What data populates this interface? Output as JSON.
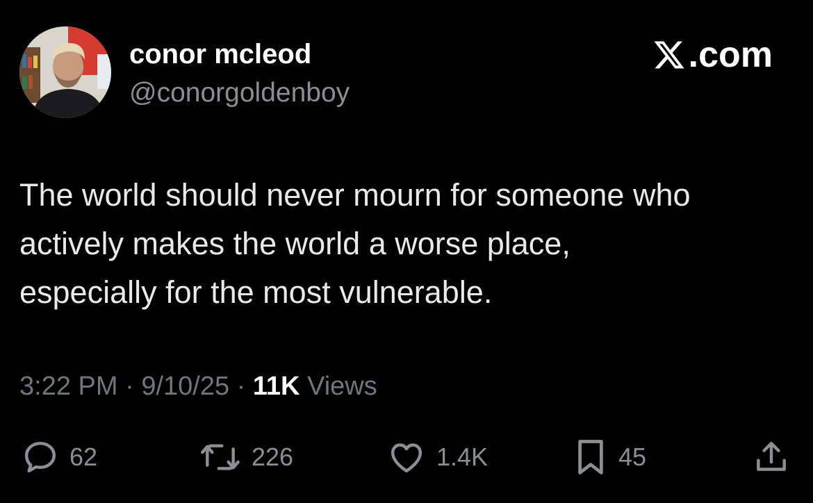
{
  "author": {
    "display_name": "conor mcleod",
    "handle": "@conorgoldenboy"
  },
  "brand": {
    "text": ".com",
    "icon": "x-logo-icon"
  },
  "tweet": {
    "lines": [
      "The world should never mourn for someone who",
      "actively makes the world a worse place,",
      "especially for the most vulnerable."
    ]
  },
  "meta": {
    "time": "3:22 PM",
    "separator": " · ",
    "date": "9/10/25",
    "views_count": "11K",
    "views_label": " Views"
  },
  "actions": {
    "replies": "62",
    "retweets": "226",
    "likes": "1.4K",
    "bookmarks": "45"
  },
  "colors": {
    "background": "#000000",
    "primary_text": "#e7e9ea",
    "secondary_text": "#71767b"
  }
}
